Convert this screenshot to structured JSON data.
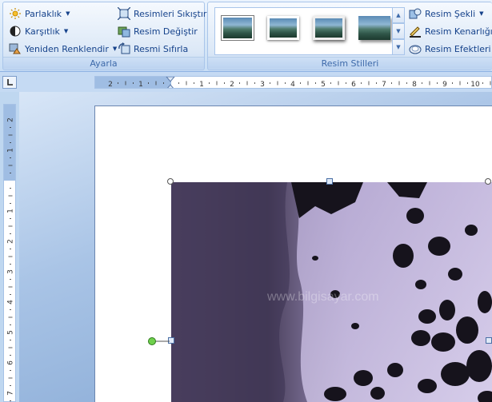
{
  "ribbon": {
    "adjust_group": {
      "label": "Ayarla",
      "brightness": "Parlaklık",
      "contrast": "Karşıtlık",
      "recolor": "Yeniden Renklendir",
      "compress": "Resimleri Sıkıştır",
      "change_picture": "Resim Değiştir",
      "reset_picture": "Resmi Sıfırla"
    },
    "styles_group": {
      "label": "Resim Stilleri",
      "shape": "Resim Şekli",
      "border": "Resim Kenarlığı",
      "effects": "Resim Efektleri",
      "gallery_count": 4
    }
  },
  "ruler": {
    "horizontal_numbers": [
      "2",
      "1",
      "1",
      "2",
      "3",
      "4",
      "5",
      "6",
      "7",
      "8",
      "9",
      "10"
    ],
    "vertical_numbers": [
      "2",
      "1",
      "1",
      "2",
      "3",
      "4",
      "5",
      "6",
      "7"
    ]
  },
  "watermark": "www.bilgisayar.com",
  "colors": {
    "accent": "#15428b",
    "ribbon_bg": "#dbe8f8",
    "workspace": "#a9c4e6"
  },
  "icons": {
    "brightness": "sun-icon",
    "contrast": "contrast-icon",
    "recolor": "recolor-icon",
    "compress": "compress-icon",
    "change": "change-picture-icon",
    "reset": "reset-picture-icon",
    "shape": "picture-shape-icon",
    "border": "picture-border-icon",
    "effects": "picture-effects-icon"
  }
}
